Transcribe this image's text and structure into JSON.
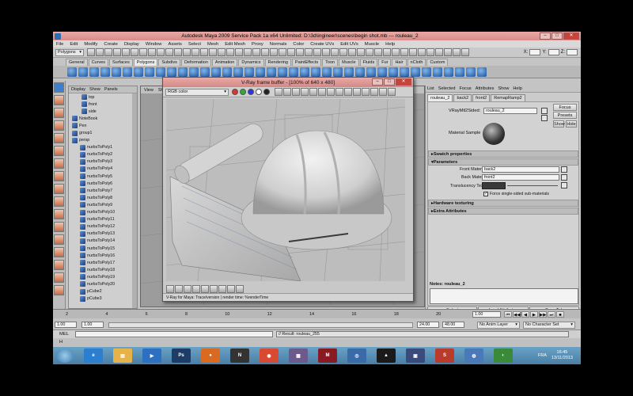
{
  "window": {
    "title": "Autodesk Maya 2009 Service Pack 1a x64 Unlimited: D:\\3d\\ingineer\\scenes\\begin shot.mb   ---   rouleau_2",
    "minimize": "–",
    "maximize": "□",
    "close": "✕"
  },
  "menubar": [
    "File",
    "Edit",
    "Modify",
    "Create",
    "Display",
    "Window",
    "Assets",
    "Select",
    "Mesh",
    "Edit Mesh",
    "Proxy",
    "Normals",
    "Color",
    "Create UVs",
    "Edit UVs",
    "Muscle",
    "Help"
  ],
  "status": {
    "mode": "Polygons",
    "x_label": "X:",
    "y_label": "Y:",
    "z_label": "Z:"
  },
  "shelf_tabs": [
    "General",
    "Curves",
    "Surfaces",
    "Polygons",
    "Subdivs",
    "Deformation",
    "Animation",
    "Dynamics",
    "Rendering",
    "PaintEffects",
    "Toon",
    "Muscle",
    "Fluids",
    "Fur",
    "Hair",
    "nCloth",
    "Custom"
  ],
  "outliner": {
    "menu": [
      "Display",
      "Show",
      "Panels"
    ],
    "items": [
      "top",
      "front",
      "side",
      "NoteBook",
      "Pen",
      "group1",
      "persp",
      "nurbsToPoly1",
      "nurbsToPoly2",
      "nurbsToPoly3",
      "nurbsToPoly4",
      "nurbsToPoly5",
      "nurbsToPoly6",
      "nurbsToPoly7",
      "nurbsToPoly8",
      "nurbsToPoly9",
      "nurbsToPoly10",
      "nurbsToPoly11",
      "nurbsToPoly12",
      "nurbsToPoly13",
      "nurbsToPoly14",
      "nurbsToPoly15",
      "nurbsToPoly16",
      "nurbsToPoly17",
      "nurbsToPoly18",
      "nurbsToPoly19",
      "nurbsToPoly20",
      "pCube2",
      "pCube3"
    ]
  },
  "viewport": {
    "menu": [
      "View",
      "Sh"
    ]
  },
  "vray": {
    "title": "V-Ray frame buffer - [100% of 640 x 480]",
    "channel": "RGB color",
    "status": "V-Ray for Maya: Trace/version  | render time: %renderTime"
  },
  "attr": {
    "menu": [
      "List",
      "Selected",
      "Focus",
      "Attributes",
      "Show",
      "Help"
    ],
    "tabs": [
      "rouleau_2",
      "back2",
      "front2",
      "RemapRamp2"
    ],
    "node_type": "VRayMtl2Sided:",
    "node_name": "rouleau_2",
    "focus": "Focus",
    "presets": "Presets",
    "show": "Show",
    "hide": "Hide",
    "sample_label": "Material Sample",
    "sections": {
      "swatch": "Swatch properties",
      "params": "Parameters",
      "hardware": "Hardware texturing",
      "extra": "Extra Attributes"
    },
    "front_label": "Front Material",
    "front_value": "back2",
    "back_label": "Back Material",
    "back_value": "front2",
    "trans_label": "Translucency Tex",
    "force_label": "Force single-sided sub-materials",
    "notes": "Notes:  rouleau_2",
    "select": "Select",
    "load": "Load Attributes",
    "copy": "Copy Tab"
  },
  "timeline": {
    "ticks": [
      "2",
      "4",
      "6",
      "8",
      "10",
      "12",
      "14",
      "16",
      "18",
      "20",
      "22",
      "24"
    ],
    "current": "1.00"
  },
  "range": {
    "start": "1.00",
    "start2": "1.00",
    "end": "24.00",
    "end2": "48.00",
    "anim_layer": "No Anim Layer",
    "char_set": "No Character Set"
  },
  "cmd": {
    "label": "MEL",
    "result": "// Result: rouleau_255"
  },
  "helpline": "H",
  "taskbar": {
    "icons": [
      {
        "name": "ie",
        "color": "#2c7fd0",
        "label": "e"
      },
      {
        "name": "explorer",
        "color": "#e5b34a",
        "label": "▤"
      },
      {
        "name": "mediaplayer",
        "color": "#2d6fc0",
        "label": "▶"
      },
      {
        "name": "photoshop",
        "color": "#1d3d67",
        "label": "Ps"
      },
      {
        "name": "firefox",
        "color": "#d86a22",
        "label": "●"
      },
      {
        "name": "nuke",
        "color": "#333333",
        "label": "N"
      },
      {
        "name": "chrome",
        "color": "#d84a32",
        "label": "◉"
      },
      {
        "name": "winrar",
        "color": "#6d5a8c",
        "label": "▦"
      },
      {
        "name": "maya",
        "color": "#8a1a22",
        "label": "M"
      },
      {
        "name": "network",
        "color": "#3a6aa8",
        "label": "◎"
      },
      {
        "name": "avid",
        "color": "#1a1a1a",
        "label": "▲"
      },
      {
        "name": "app",
        "color": "#3a4a7a",
        "label": "▣"
      },
      {
        "name": "sketchup",
        "color": "#b83b2c",
        "label": "S"
      },
      {
        "name": "globe",
        "color": "#4a78b8",
        "label": "◍"
      },
      {
        "name": "other",
        "color": "#3a8a3a",
        "label": "◐"
      }
    ],
    "lang": "FRA",
    "time": "16:45",
    "date": "13/11/2013"
  }
}
